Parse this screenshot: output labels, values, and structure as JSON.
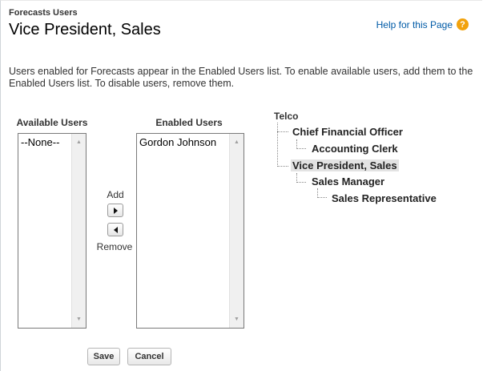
{
  "header": {
    "section_label": "Forecasts Users",
    "title": "Vice President, Sales",
    "help_link": "Help for this Page",
    "help_icon": "?"
  },
  "description": "Users enabled for Forecasts appear in the Enabled Users list. To enable available users, add them to the Enabled Users list. To disable users, remove them.",
  "available": {
    "header": "Available Users",
    "options": [
      "--None--"
    ]
  },
  "enabled": {
    "header": "Enabled Users",
    "options": [
      "Gordon Johnson"
    ]
  },
  "move": {
    "add_label": "Add",
    "remove_label": "Remove"
  },
  "hierarchy": {
    "root": "Telco",
    "nodes": [
      {
        "label": "Chief Financial Officer",
        "level": 1
      },
      {
        "label": "Accounting Clerk",
        "level": 2
      },
      {
        "label": "Vice President, Sales",
        "level": 1,
        "selected": true
      },
      {
        "label": "Sales Manager",
        "level": 2
      },
      {
        "label": "Sales Representative",
        "level": 3
      }
    ]
  },
  "actions": {
    "save_label": "Save",
    "cancel_label": "Cancel"
  }
}
